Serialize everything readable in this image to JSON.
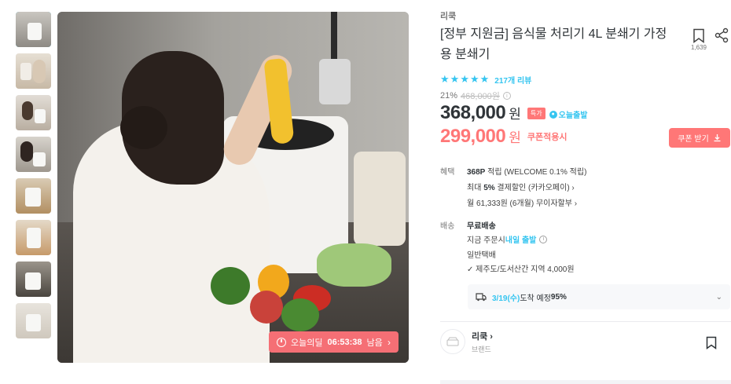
{
  "thumbnails": [
    {
      "label": "thumb-1",
      "active": true
    },
    {
      "label": "thumb-2",
      "active": false
    },
    {
      "label": "thumb-3",
      "active": false
    },
    {
      "label": "thumb-4",
      "active": false
    },
    {
      "label": "thumb-5",
      "active": false
    },
    {
      "label": "thumb-6",
      "active": false
    },
    {
      "label": "thumb-7",
      "active": false
    },
    {
      "label": "thumb-8",
      "active": false
    }
  ],
  "timer": {
    "label": "오늘의딜",
    "time": "06:53:38",
    "suffix": "남음"
  },
  "product": {
    "brand": "리쿡",
    "title": "[정부 지원금] 음식물 처리기 4L 분쇄기 가정용 분쇄기",
    "bookmark_count": "1,639",
    "rating_stars": 5,
    "reviews": "217개 리뷰",
    "discount_pct": "21%",
    "original_price": "468,000원",
    "price": "368,000",
    "won": "원",
    "special_badge": "특가",
    "today_badge": "오늘출발",
    "coupon_price": "299,000",
    "coupon_won": "원",
    "coupon_apply": "쿠폰적용시",
    "coupon_button": "쿠폰 받기"
  },
  "benefits": {
    "label": "혜택",
    "points_bold": "368P",
    "points_rest": " 적립 (WELCOME 0.1% 적립)",
    "max_prefix": "최대 ",
    "max_bold": "5%",
    "max_rest": " 결제할인 (카카오페이) ›",
    "installment": "월 61,333원 (6개월) 무이자할부 ›"
  },
  "shipping": {
    "label": "배송",
    "free": "무료배송",
    "order_prefix": "지금 주문시 ",
    "order_bold": "내일 출발",
    "standard": "일반택배",
    "jeju": "✓ 제주도/도서산간 지역 4,000원",
    "eta_date": "3/19(수)",
    "eta_text": " 도착 예정 ",
    "eta_pct": "95%"
  },
  "store": {
    "name": "리쿡 ›",
    "type": "브랜드"
  },
  "colors": {
    "accent": "#35c5f0",
    "sale": "#ff7777"
  }
}
